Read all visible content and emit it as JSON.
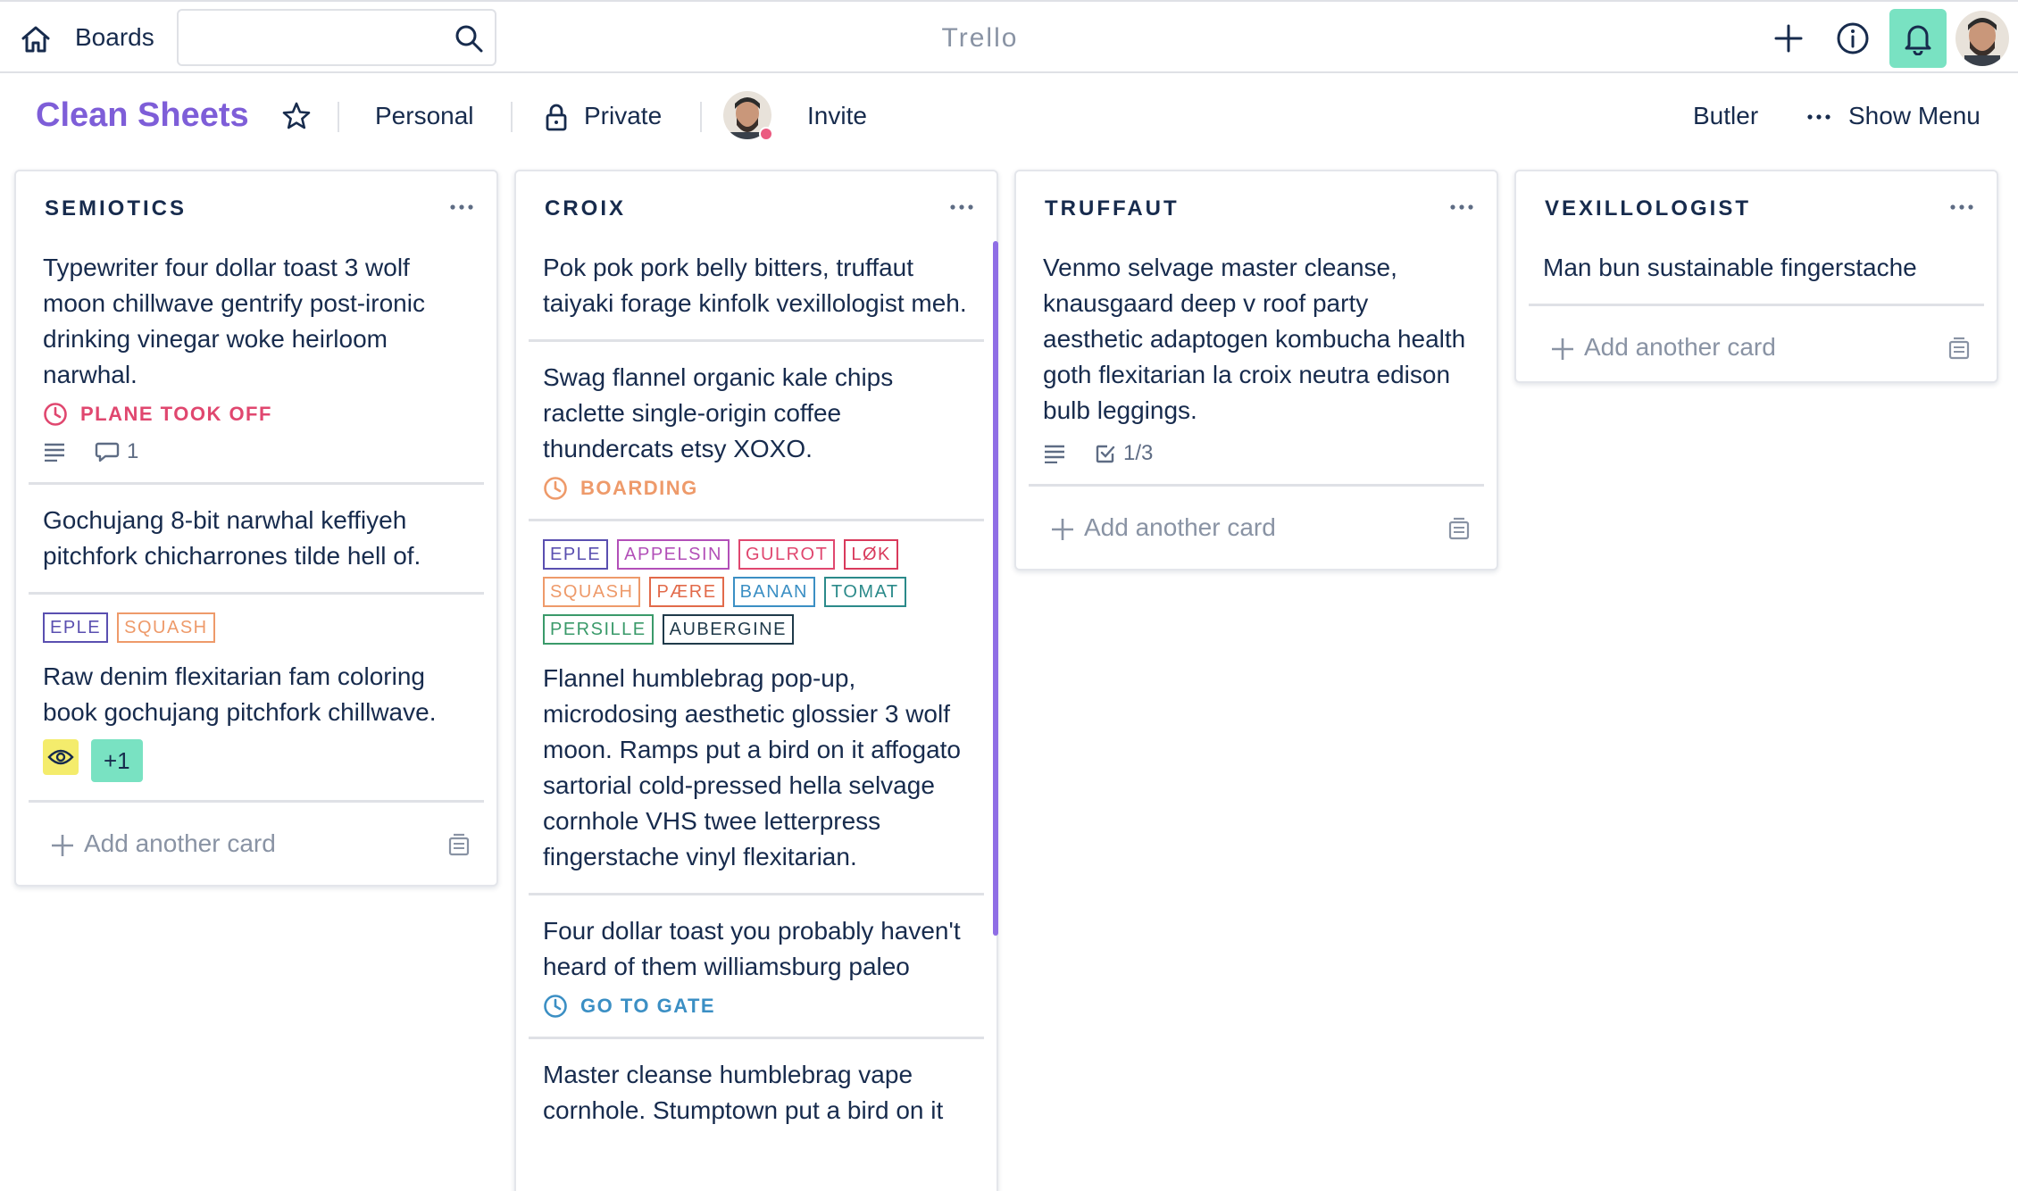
{
  "app": {
    "brand": "Trello",
    "boards_label": "Boards",
    "search_placeholder": ""
  },
  "board": {
    "title": "Clean Sheets",
    "team": "Personal",
    "visibility": "Private",
    "invite_label": "Invite",
    "butler_label": "Butler",
    "show_menu_label": "Show Menu"
  },
  "colors": {
    "accent_purple": "#7e5ed8",
    "bell_bg": "#79e2c2",
    "alert_red": "#e0476f",
    "boarding_orange": "#ee9a6a",
    "gate_blue": "#3b8fc4"
  },
  "lists": [
    {
      "title": "SEMIOTICS",
      "add_label": "Add another card",
      "cards": [
        {
          "text": "Typewriter four dollar toast 3 wolf moon chillwave gentrify post-ironic drinking vinegar woke heirloom narwhal.",
          "time": "PLANE TOOK OFF",
          "time_color": "#e0476f",
          "comments": "1"
        },
        {
          "text": "Gochujang 8-bit narwhal keffiyeh pitchfork chicharrones tilde hell of."
        },
        {
          "labels": [
            {
              "name": "EPLE",
              "color": "#5a4fb0"
            },
            {
              "name": "SQUASH",
              "color": "#ee9a6a"
            }
          ],
          "text": "Raw denim flexitarian fam coloring book gochujang pitchfork chillwave.",
          "extra_members": "+1"
        }
      ]
    },
    {
      "title": "CROIX",
      "cards": [
        {
          "text": "Pok pok pork belly bitters, truffaut taiyaki forage kinfolk vexillologist meh."
        },
        {
          "text": "Swag flannel organic kale chips raclette single-origin coffee thundercats etsy XOXO.",
          "time": "BOARDING",
          "time_color": "#ee9a6a"
        },
        {
          "labels": [
            {
              "name": "EPLE",
              "color": "#5a4fb0"
            },
            {
              "name": "APPELSIN",
              "color": "#b24fb8"
            },
            {
              "name": "GULROT",
              "color": "#e0476f"
            },
            {
              "name": "LØK",
              "color": "#d93a5c"
            },
            {
              "name": "SQUASH",
              "color": "#ee9a6a"
            },
            {
              "name": "PÆRE",
              "color": "#e26a4a"
            },
            {
              "name": "BANAN",
              "color": "#3b8fc4"
            },
            {
              "name": "TOMAT",
              "color": "#2b8a8a"
            },
            {
              "name": "PERSILLE",
              "color": "#3a9a6a"
            },
            {
              "name": "AUBERGINE",
              "color": "#1f3a4a"
            }
          ],
          "text": "Flannel humblebrag pop-up, microdosing aesthetic glossier 3 wolf moon. Ramps put a bird on it affogato sartorial cold-pressed hella selvage cornhole VHS twee letterpress fingerstache vinyl flexitarian."
        },
        {
          "text": "Four dollar toast you probably haven't heard of them williamsburg paleo",
          "time": "GO TO GATE",
          "time_color": "#3b8fc4"
        },
        {
          "text": "Master cleanse humblebrag vape cornhole. Stumptown put a bird on it"
        }
      ]
    },
    {
      "title": "TRUFFAUT",
      "add_label": "Add another card",
      "cards": [
        {
          "text": "Venmo selvage master cleanse, knausgaard deep v roof party aesthetic adaptogen kombucha health goth flexitarian la croix neutra edison bulb leggings.",
          "checklist": "1/3"
        }
      ]
    },
    {
      "title": "VEXILLOLOGIST",
      "add_label": "Add another card",
      "cards": [
        {
          "text": "Man bun sustainable fingerstache"
        }
      ]
    }
  ]
}
